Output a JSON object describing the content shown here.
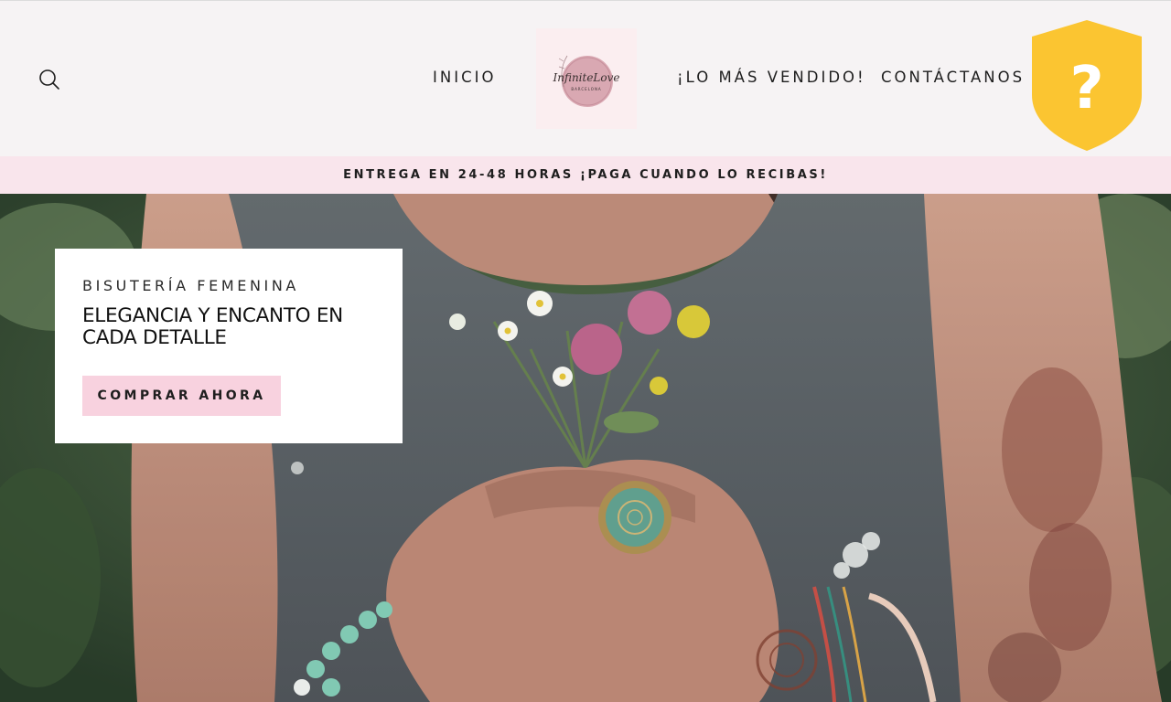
{
  "header": {
    "nav": {
      "inicio": "INICIO",
      "mas_vendido": "¡LO MÁS VENDIDO!",
      "contacto": "CONTÁCTANOS"
    },
    "logo": {
      "text": "InfiniteLove",
      "subtext": "BARCELONA"
    },
    "search_icon": "search-icon",
    "help_icon": "question-shield-icon"
  },
  "announcement": {
    "text": "ENTREGA EN 24-48 HORAS ¡PAGA CUANDO LO RECIBAS!"
  },
  "hero": {
    "image": "woman-holding-wildflowers-photo",
    "subtitle": "BISUTERÍA FEMENINA",
    "title": "ELEGANCIA Y ENCANTO EN CADA DETALLE",
    "button_label": "COMPRAR AHORA"
  },
  "colors": {
    "header_bg": "#f6f3f4",
    "announcement_bg": "#f9e5ec",
    "button_bg": "#f8d2df",
    "help_badge": "#fbc531",
    "logo_bg": "#fbeef0"
  }
}
